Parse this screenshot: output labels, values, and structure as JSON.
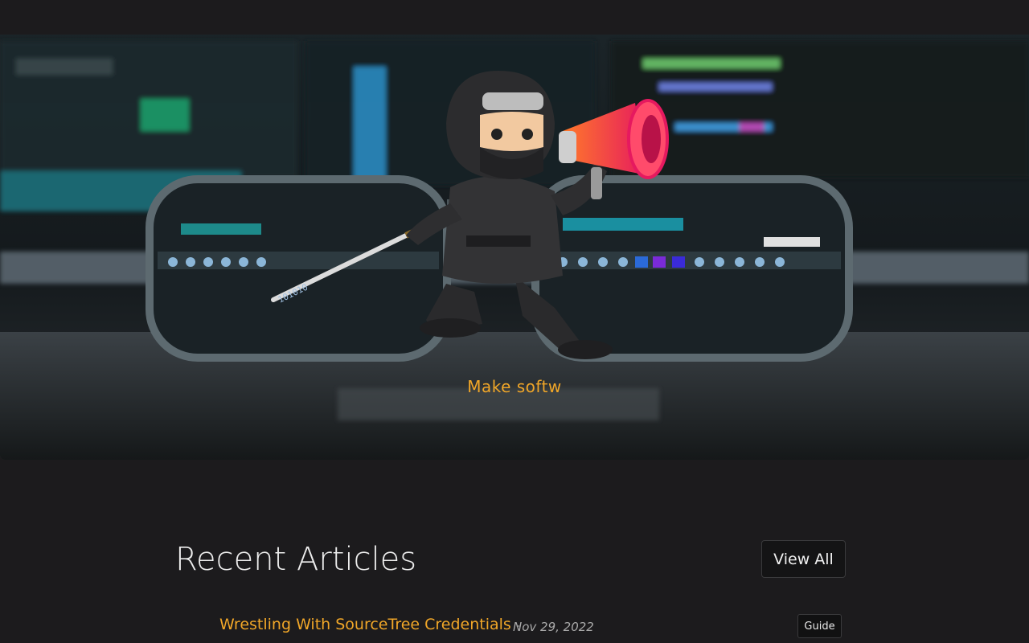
{
  "hero": {
    "tagline": "Make softw",
    "mascot_icon": "ninja-with-megaphone-icon",
    "accent_color": "#f0a628"
  },
  "recent": {
    "title": "Recent Articles",
    "view_all_label": "View All",
    "articles": [
      {
        "title": "Wrestling With SourceTree Credentials",
        "separator": "-",
        "date": "Nov 29, 2022",
        "tag": "Guide"
      }
    ]
  }
}
